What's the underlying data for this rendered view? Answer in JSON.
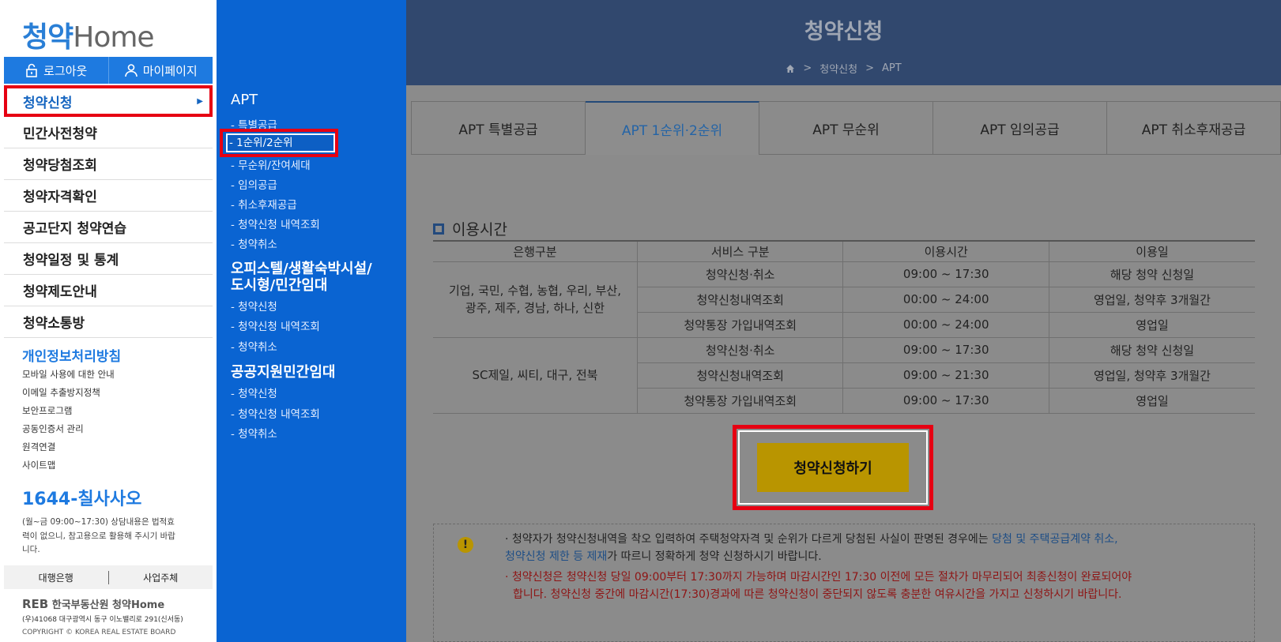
{
  "logo": {
    "part1": "청약",
    "part2": "Home"
  },
  "userbar": {
    "logout": "로그아웃",
    "mypage": "마이페이지"
  },
  "main_menu": [
    "청약신청",
    "민간사전청약",
    "청약당첨조회",
    "청약자격확인",
    "공고단지 청약연습",
    "청약일정 및 통계",
    "청약제도안내",
    "청약소통방"
  ],
  "privacy_title": "개인정보처리방침",
  "sidebar_links": [
    "모바일 사용에 대한 안내",
    "이메일 추출방지정책",
    "보안프로그램",
    "공동인증서 관리",
    "원격연결",
    "사이트맵"
  ],
  "phone": "1644-칠사사오",
  "phone_note": "(월~금 09:00~17:30) 상담내용은 법적효력이 없으니, 참고용으로 활용해 주시기 바랍니다.",
  "partner": {
    "bank": "대행은행",
    "business": "사업주체"
  },
  "footer": {
    "reb": "REB",
    "org": "한국부동산원 청약Home",
    "address": "(우)41068 대구광역시 동구 이노밸리로 291(신서동)",
    "copyright": "COPYRIGHT © KOREA REAL ESTATE BOARD"
  },
  "submenu": {
    "apt_title": "APT",
    "apt_items": [
      "- 특별공급",
      "- 1순위/2순위",
      "- 무순위/잔여세대",
      "- 임의공급",
      "- 취소후재공급",
      "- 청약신청 내역조회",
      "- 청약취소"
    ],
    "officetel_title_1": "오피스텔/생활숙박시설/",
    "officetel_title_2": "도시형/민간임대",
    "officetel_items": [
      "- 청약신청",
      "- 청약신청 내역조회",
      "- 청약취소"
    ],
    "public_title": "공공지원민간임대",
    "public_items": [
      "- 청약신청",
      "- 청약신청 내역조회",
      "- 청약취소"
    ]
  },
  "page": {
    "title": "청약신청",
    "breadcrumb": [
      "청약신청",
      "APT"
    ]
  },
  "tabs": [
    "APT 특별공급",
    "APT 1순위·2순위",
    "APT 무순위",
    "APT 임의공급",
    "APT 취소후재공급"
  ],
  "section_title": "이용시간",
  "table": {
    "headers": [
      "은행구분",
      "서비스 구분",
      "이용시간",
      "이용일"
    ],
    "group1_bank": [
      "기업, 국민, 수협, 농협, 우리, 부산,",
      "광주, 제주, 경남, 하나, 신한"
    ],
    "group1_rows": [
      [
        "청약신청·취소",
        "09:00 ~ 17:30",
        "해당 청약 신청일"
      ],
      [
        "청약신청내역조회",
        "00:00 ~ 24:00",
        "영업일, 청약후 3개월간"
      ],
      [
        "청약통장 가입내역조회",
        "00:00 ~ 24:00",
        "영업일"
      ]
    ],
    "group2_bank": "SC제일, 씨티, 대구, 전북",
    "group2_rows": [
      [
        "청약신청·취소",
        "09:00 ~ 17:30",
        "해당 청약 신청일"
      ],
      [
        "청약신청내역조회",
        "09:00 ~ 21:30",
        "영업일, 청약후 3개월간"
      ],
      [
        "청약통장 가입내역조회",
        "09:00 ~ 17:30",
        "영업일"
      ]
    ]
  },
  "apply_button": "청약신청하기",
  "notice": {
    "icon": "!",
    "line1_a": "· 청약자가 청약신청내역을 착오 입력하여 주택청약자격 및 순위가 다르게 당첨된 사실이 판명된 경우에는 ",
    "line1_b": "당첨 및 주택공급계약 취소,",
    "line2_a": "청약신청 제한 등 제재",
    "line2_b": "가 따르니 정확하게 청약 신청하시기 바랍니다.",
    "line3": "· 청약신청은 청약신청 당일 09:00부터 17:30까지 가능하며 마감시간인 17:30 이전에 모든 절차가 마무리되어 최종신청이 완료되어야",
    "line4": "합니다. 청약신청 중간에 마감시간(17:30)경과에 따른 청약신청이 중단되지 않도록 충분한 여유시간을 가지고 신청하시기 바랍니다."
  },
  "colors": {
    "accent_blue": "#0a64d2",
    "highlight_red": "#e60012",
    "apply_yellow": "#b99500"
  }
}
